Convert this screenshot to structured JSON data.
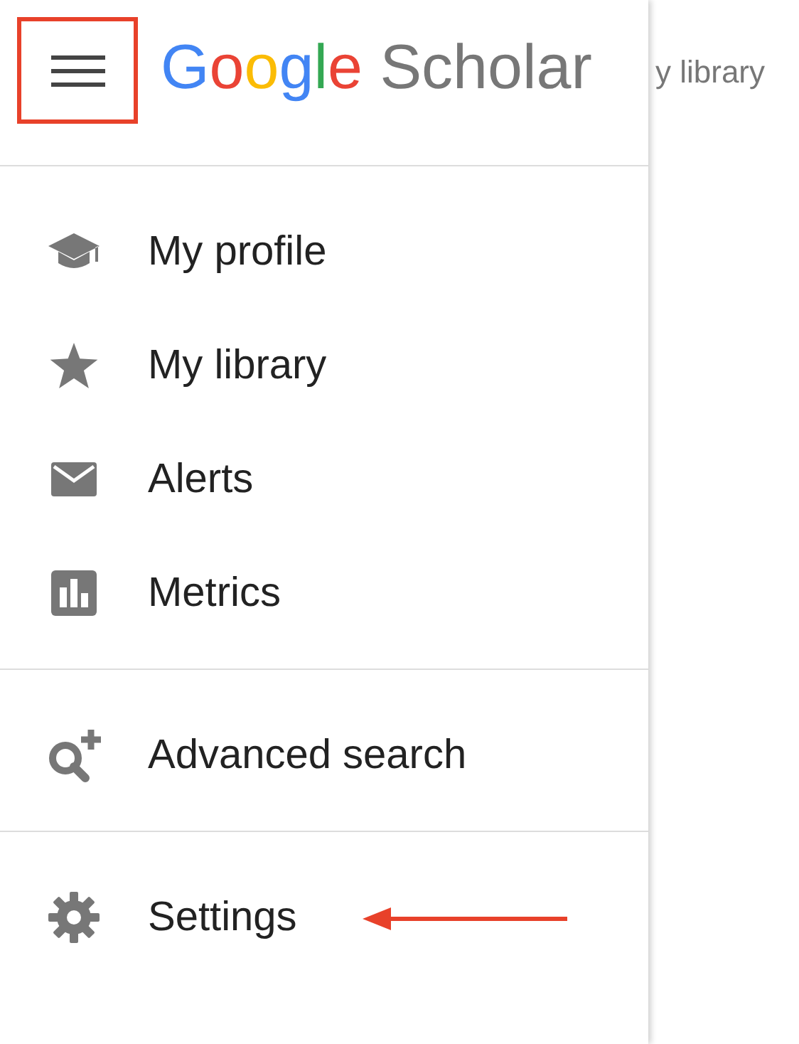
{
  "background": {
    "text": "y library"
  },
  "menu_button": {
    "highlighted": true
  },
  "logo": {
    "letters": [
      {
        "text": "G",
        "color": "#4285f4"
      },
      {
        "text": "o",
        "color": "#ea4335"
      },
      {
        "text": "o",
        "color": "#fbbc05"
      },
      {
        "text": "g",
        "color": "#4285f4"
      },
      {
        "text": "l",
        "color": "#34a853"
      },
      {
        "text": "e",
        "color": "#ea4335"
      }
    ],
    "suffix": "Scholar"
  },
  "sections": [
    {
      "items": [
        {
          "label": "My profile",
          "pointed": false
        },
        {
          "label": "My library",
          "pointed": false
        },
        {
          "label": "Alerts",
          "pointed": false
        },
        {
          "label": "Metrics",
          "pointed": false
        }
      ]
    },
    {
      "items": [
        {
          "label": "Advanced search",
          "pointed": false
        }
      ]
    },
    {
      "items": [
        {
          "label": "Settings",
          "pointed": true
        }
      ]
    }
  ]
}
